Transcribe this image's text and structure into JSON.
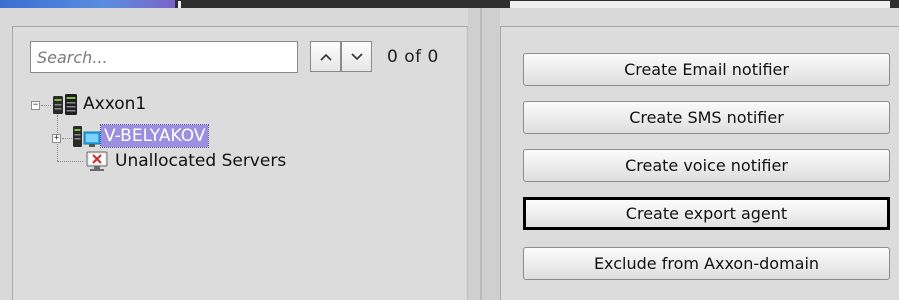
{
  "search": {
    "placeholder": "Search...",
    "value": "",
    "counter": "0 of 0"
  },
  "tree": {
    "root": {
      "label": "Axxon1",
      "expanded": true,
      "icon": "server-group-icon"
    },
    "children": [
      {
        "label": "V-BELYAKOV",
        "selected": true,
        "expanded": false,
        "icon": "server-node-icon"
      },
      {
        "label": "Unallocated Servers",
        "icon": "unallocated-servers-icon"
      }
    ]
  },
  "actions": [
    {
      "label": "Create Email notifier",
      "focused": false
    },
    {
      "label": "Create SMS notifier",
      "focused": false
    },
    {
      "label": "Create voice notifier",
      "focused": false
    },
    {
      "label": "Create export agent",
      "focused": true
    },
    {
      "label": "Exclude from Axxon-domain",
      "focused": false
    }
  ],
  "colors": {
    "selection": "#9b8fe0",
    "panel": "#dcdcdc",
    "focus_border": "#000000"
  }
}
